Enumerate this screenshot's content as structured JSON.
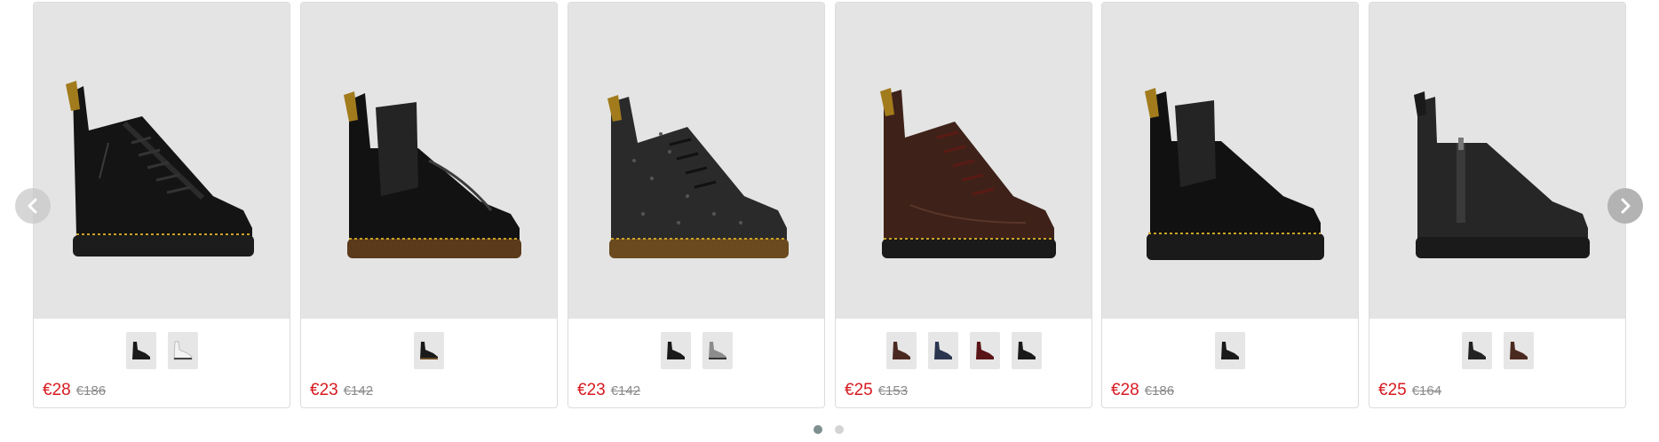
{
  "products": [
    {
      "price": "€28",
      "old_price": "€186",
      "image_icon": "black-leather-platform-lace-up-boot",
      "swatches": [
        {
          "icon": "black-boot-swatch",
          "color": "#1a1a1a"
        },
        {
          "icon": "white-boot-swatch",
          "color": "#f2f2f2"
        }
      ]
    },
    {
      "price": "€23",
      "old_price": "€142",
      "image_icon": "black-patent-chelsea-boot",
      "swatches": [
        {
          "icon": "black-boot-swatch",
          "color": "#1a1a1a"
        }
      ]
    },
    {
      "price": "€23",
      "old_price": "€142",
      "image_icon": "black-glitter-lace-up-boot",
      "swatches": [
        {
          "icon": "black-boot-swatch",
          "color": "#1a1a1a"
        },
        {
          "icon": "silver-glitter-boot-swatch",
          "color": "#8c8c8c"
        }
      ]
    },
    {
      "price": "€25",
      "old_price": "€153",
      "image_icon": "brown-leather-lace-up-boot",
      "swatches": [
        {
          "icon": "brown-boot-swatch",
          "color": "#4a2a20"
        },
        {
          "icon": "navy-boot-swatch",
          "color": "#2a3550"
        },
        {
          "icon": "cherry-red-boot-swatch",
          "color": "#5a1416"
        },
        {
          "icon": "black-boot-swatch",
          "color": "#1a1a1a"
        }
      ]
    },
    {
      "price": "€28",
      "old_price": "€186",
      "image_icon": "black-platform-chelsea-boot",
      "swatches": [
        {
          "icon": "black-boot-swatch",
          "color": "#1a1a1a"
        }
      ]
    },
    {
      "price": "€25",
      "old_price": "€164",
      "image_icon": "black-zip-chelsea-boot",
      "swatches": [
        {
          "icon": "black-boot-swatch",
          "color": "#222222"
        },
        {
          "icon": "brown-boot-swatch",
          "color": "#4a2a20"
        }
      ]
    }
  ],
  "navigation": {
    "prev_icon": "chevron-left-icon",
    "next_icon": "chevron-right-icon"
  },
  "pagination": {
    "pages": 2,
    "active_page": 1
  },
  "colors": {
    "price_red": "#d71a20",
    "old_price_gray": "#8a8a8a",
    "image_background": "#e4e4e4",
    "active_dot": "#7d8f8e",
    "inactive_dot": "#d4d4d4"
  }
}
